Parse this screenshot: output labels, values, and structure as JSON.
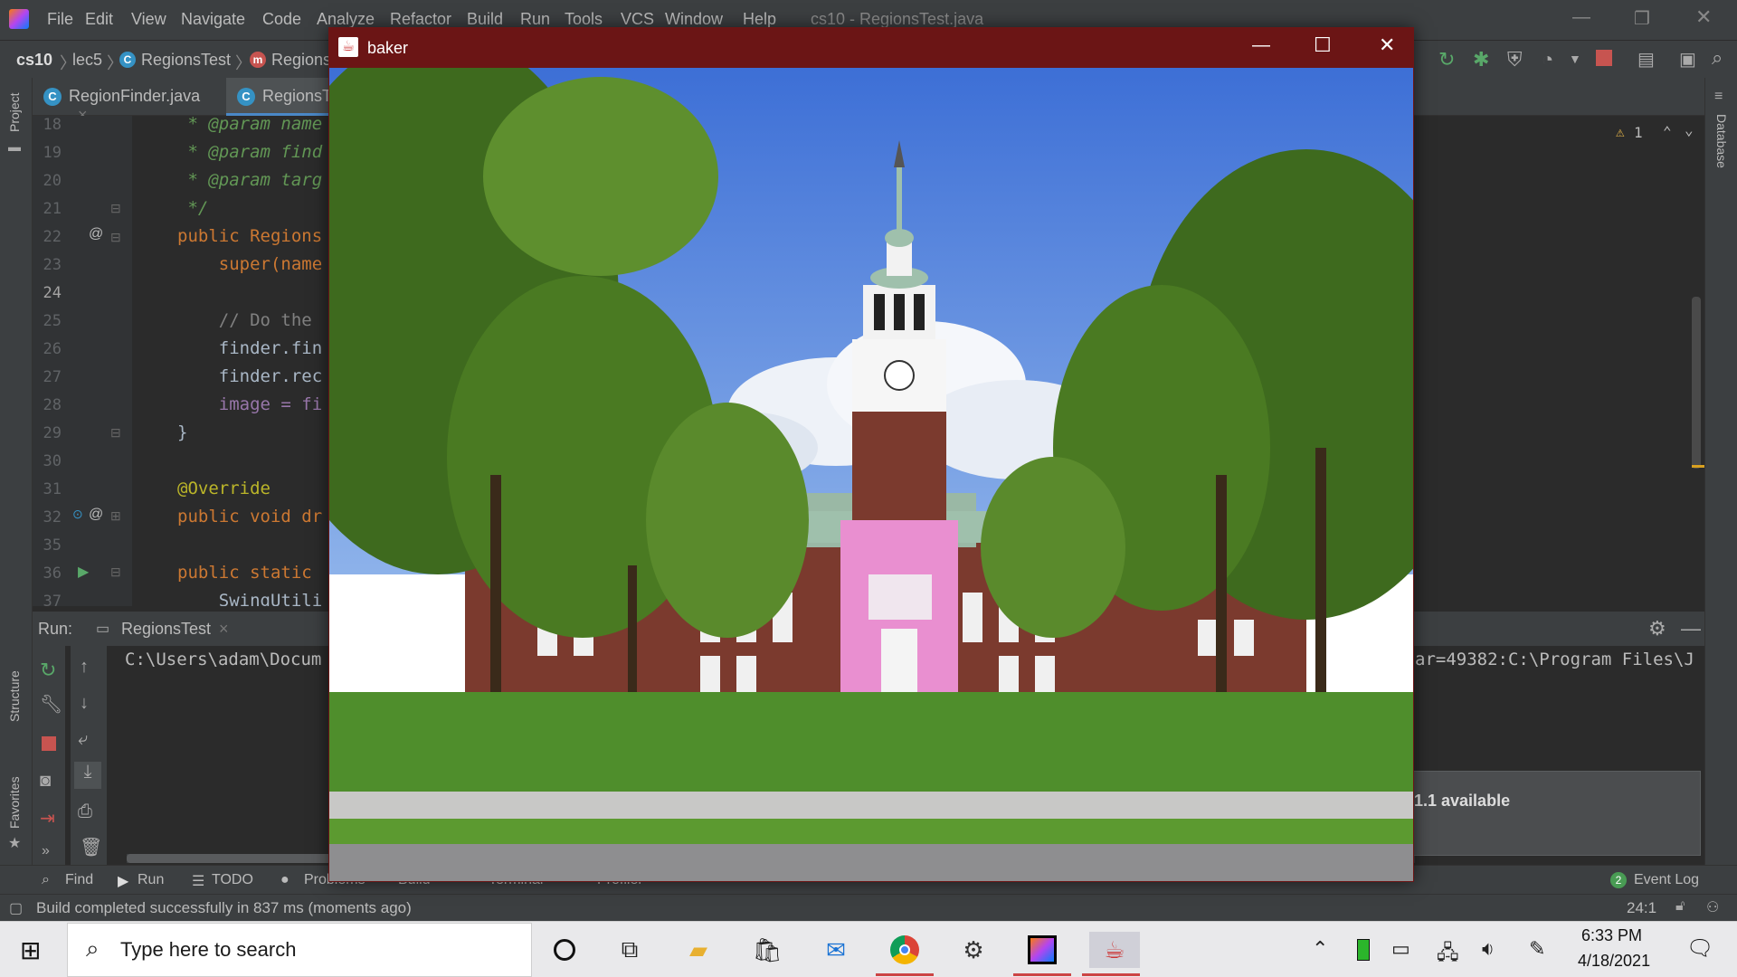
{
  "menubar": {
    "items": [
      "File",
      "Edit",
      "View",
      "Navigate",
      "Code",
      "Analyze",
      "Refactor",
      "Build",
      "Run",
      "Tools",
      "VCS",
      "Window",
      "Help"
    ],
    "window_title": "cs10 - RegionsTest.java"
  },
  "navbar": {
    "breadcrumbs": [
      "cs10",
      "lec5",
      "RegionsTest",
      "Regions"
    ]
  },
  "tabs": [
    {
      "label": "RegionFinder.java",
      "close": "×"
    },
    {
      "label": "RegionsT"
    }
  ],
  "editor": {
    "lines": [
      {
        "num": "18",
        "text": " * @param name"
      },
      {
        "num": "19",
        "text": " * @param find"
      },
      {
        "num": "20",
        "text": " * @param targ"
      },
      {
        "num": "21",
        "text": " */"
      },
      {
        "num": "22",
        "text": "public Regions"
      },
      {
        "num": "23",
        "text": "    super(name"
      },
      {
        "num": "24",
        "text": ""
      },
      {
        "num": "25",
        "text": "    // Do the"
      },
      {
        "num": "26",
        "text": "    finder.fin"
      },
      {
        "num": "27",
        "text": "    finder.rec"
      },
      {
        "num": "28",
        "text": "    image = fi"
      },
      {
        "num": "29",
        "text": "}"
      },
      {
        "num": "30",
        "text": ""
      },
      {
        "num": "31",
        "text": "@Override"
      },
      {
        "num": "32",
        "text": "public void dr"
      },
      {
        "num": "35",
        "text": ""
      },
      {
        "num": "36",
        "text": "public static"
      },
      {
        "num": "37",
        "text": "    SwingUtili"
      }
    ],
    "warnings": "1"
  },
  "run_panel": {
    "label": "Run:",
    "tab": "RegionsTest",
    "output_left": "C:\\Users\\adam\\Docum",
    "output_right": "ar=49382:C:\\Program Files\\J"
  },
  "notification": {
    "text": "1.1 available"
  },
  "bottom_tabs": [
    "Find",
    "Run",
    "TODO",
    "Problems",
    "Build",
    "Terminal",
    "Profiler"
  ],
  "event_log": {
    "count": "2",
    "label": "Event Log"
  },
  "status": {
    "message": "Build completed successfully in 837 ms (moments ago)",
    "position": "24:1"
  },
  "side_labels": {
    "project": "Project",
    "structure": "Structure",
    "favorites": "Favorites",
    "database": "Database"
  },
  "popup": {
    "title": "baker",
    "minimize": "—",
    "maximize": "☐",
    "close": "✕"
  },
  "taskbar": {
    "search_placeholder": "Type here to search",
    "time": "6:33 PM",
    "date": "4/18/2021"
  }
}
